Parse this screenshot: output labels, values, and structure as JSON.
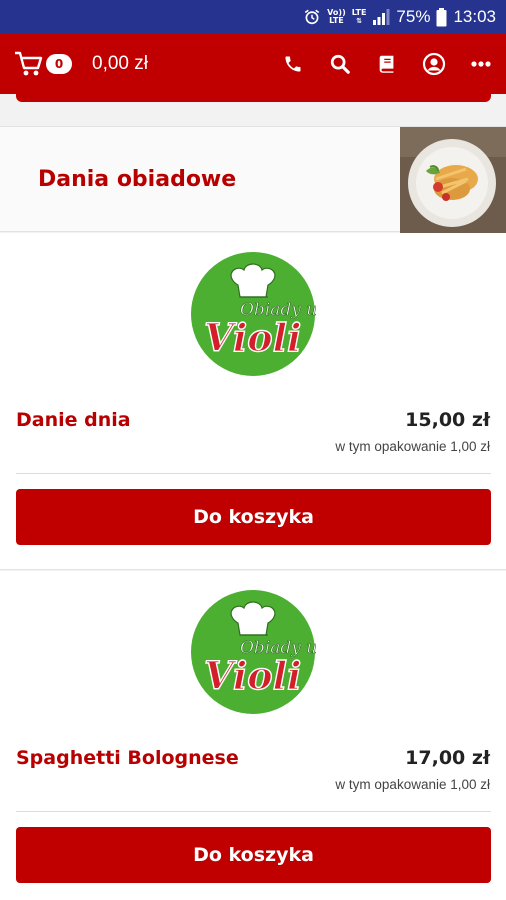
{
  "status_bar": {
    "volte_top": "Vo))",
    "volte_bottom": "LTE",
    "lte": "LTE",
    "battery": "75%",
    "time": "13:03",
    "icons": [
      "alarm-icon",
      "volte-icon",
      "lte-icon",
      "signal-icon",
      "battery-icon"
    ]
  },
  "header": {
    "cart_count": "0",
    "cart_total": "0,00 zł",
    "icons": [
      "cart-icon",
      "phone-icon",
      "search-icon",
      "menu-book-icon",
      "account-icon",
      "more-icon"
    ]
  },
  "category": {
    "title": "Dania obiadowe"
  },
  "logo": {
    "line1": "Obiady u",
    "line2": "Violi"
  },
  "products": [
    {
      "name": "Danie dnia",
      "price": "15,00 zł",
      "packaging": "w tym opakowanie 1,00 zł",
      "button": "Do koszyka"
    },
    {
      "name": "Spaghetti Bolognese",
      "price": "17,00 zł",
      "packaging": "w tym opakowanie 1,00 zł",
      "button": "Do koszyka"
    }
  ],
  "colors": {
    "status_bar": "#26338f",
    "brand_red": "#c00000",
    "logo_green": "#4caf32"
  }
}
